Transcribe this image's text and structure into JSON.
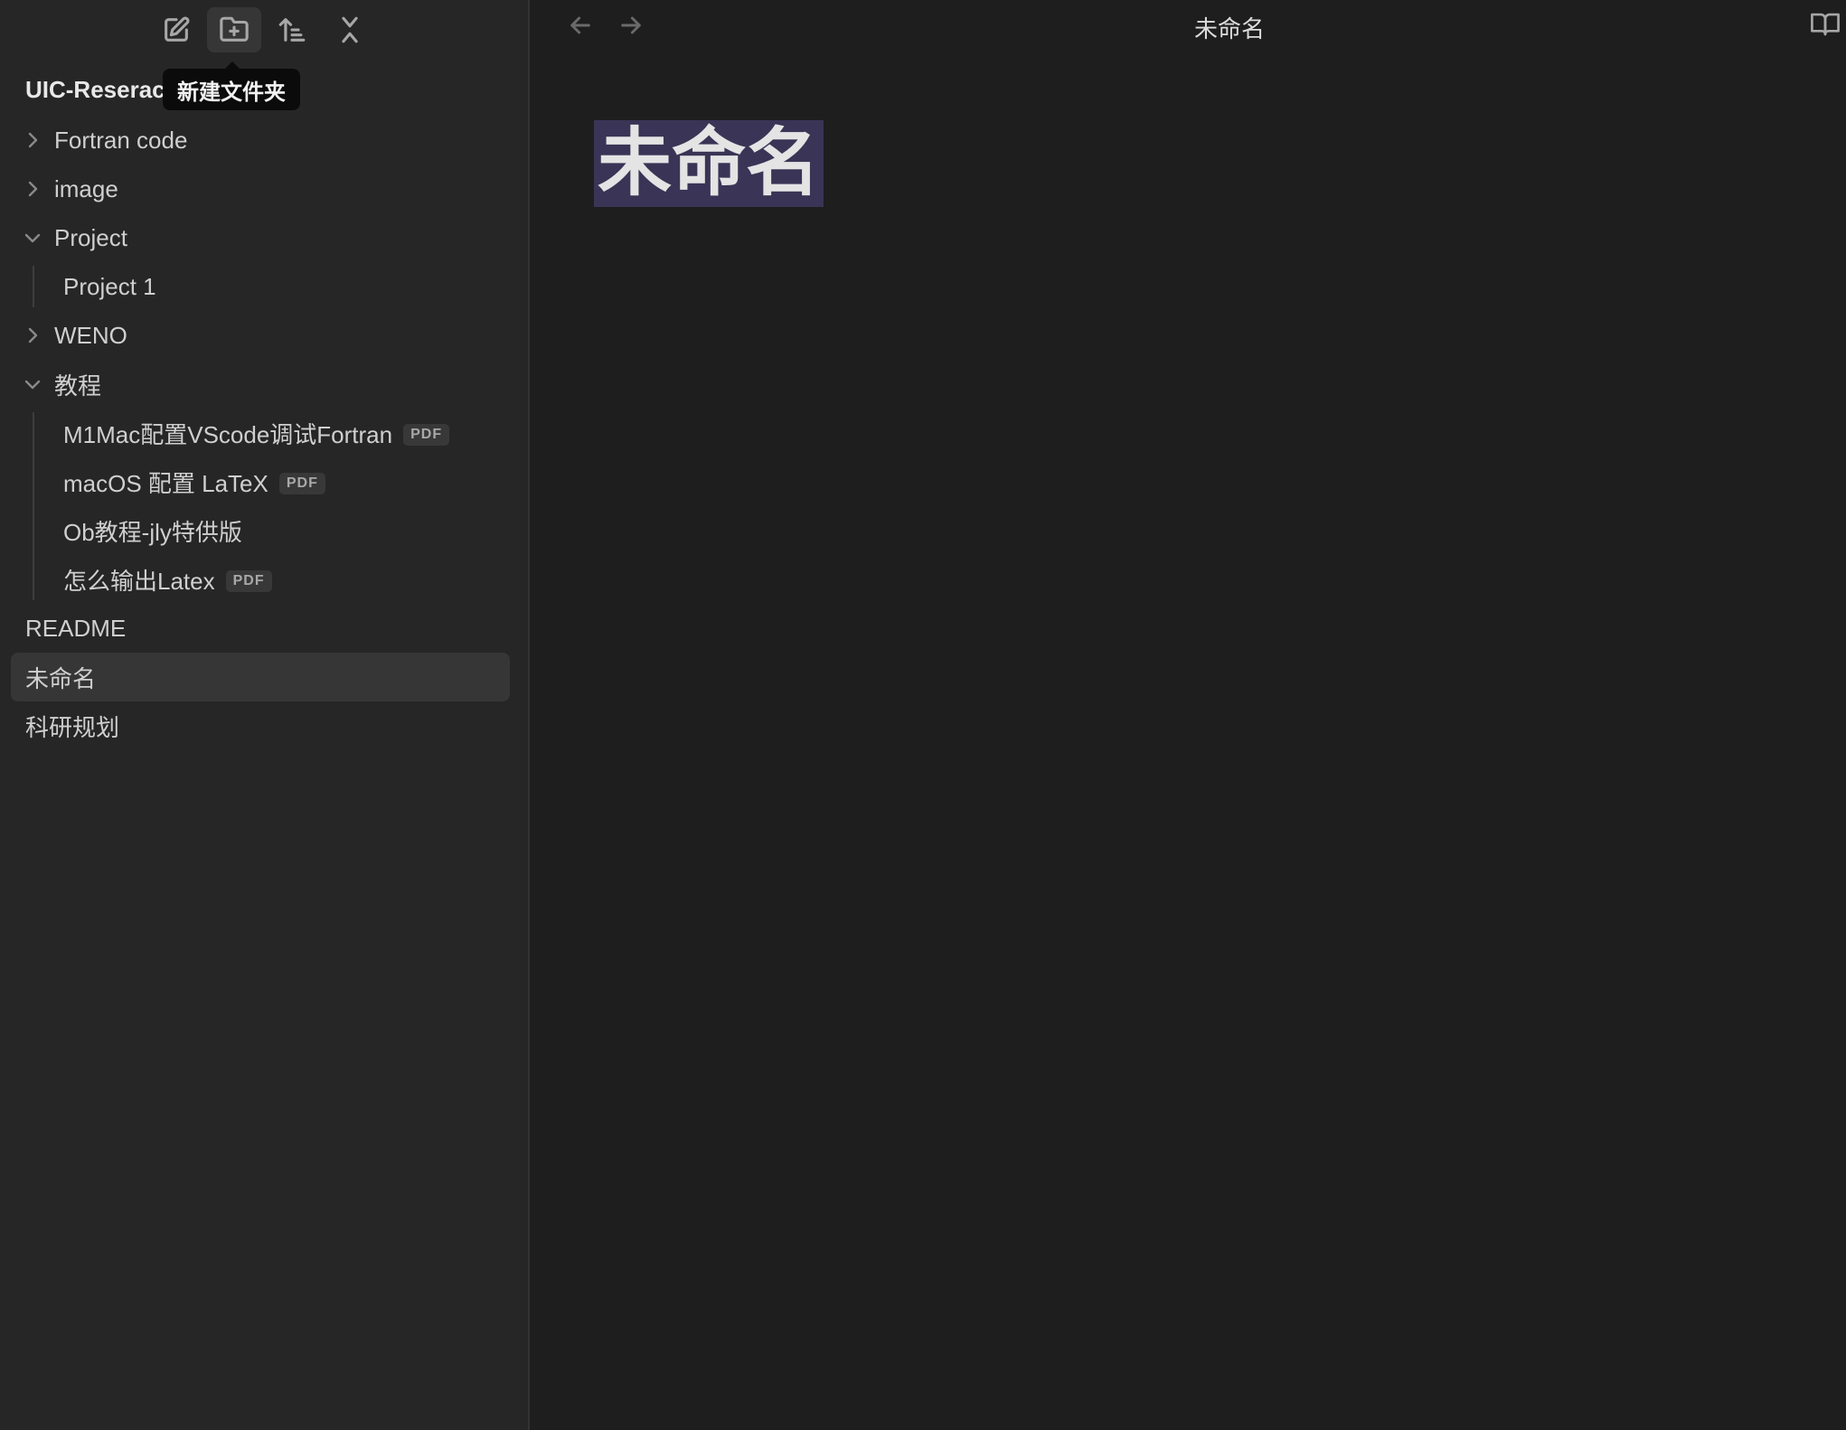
{
  "toolbar": {
    "buttons": [
      {
        "name": "new-note",
        "icon": "edit-icon"
      },
      {
        "name": "new-folder",
        "icon": "folder-plus-icon",
        "active": true
      },
      {
        "name": "change-sort-order",
        "icon": "sort-icon"
      },
      {
        "name": "collapse-all",
        "icon": "collapse-icon"
      }
    ],
    "tooltip": "新建文件夹"
  },
  "sidebar": {
    "vault_name": "UIC-Reserac",
    "tree": [
      {
        "type": "folder",
        "label": "Fortran code",
        "expanded": false
      },
      {
        "type": "folder",
        "label": "image",
        "expanded": false
      },
      {
        "type": "folder",
        "label": "Project",
        "expanded": true,
        "children": [
          {
            "label": "Project 1"
          }
        ]
      },
      {
        "type": "folder",
        "label": "WENO",
        "expanded": false
      },
      {
        "type": "folder",
        "label": "教程",
        "expanded": true,
        "children": [
          {
            "label": "M1Mac配置VScode调试Fortran",
            "badge": "PDF"
          },
          {
            "label": "macOS 配置 LaTeX",
            "badge": "PDF"
          },
          {
            "label": "Ob教程-jly特供版"
          },
          {
            "label": "怎么输出Latex",
            "badge": "PDF"
          }
        ]
      },
      {
        "type": "file",
        "label": "README"
      },
      {
        "type": "file",
        "label": "未命名",
        "selected": true
      },
      {
        "type": "file",
        "label": "科研规划"
      }
    ]
  },
  "main": {
    "view_title": "未命名",
    "doc_title": "未命名",
    "colors": {
      "background": "#1e1e1e",
      "sidebar": "#262626",
      "selection_highlight": "#3a3456"
    }
  }
}
